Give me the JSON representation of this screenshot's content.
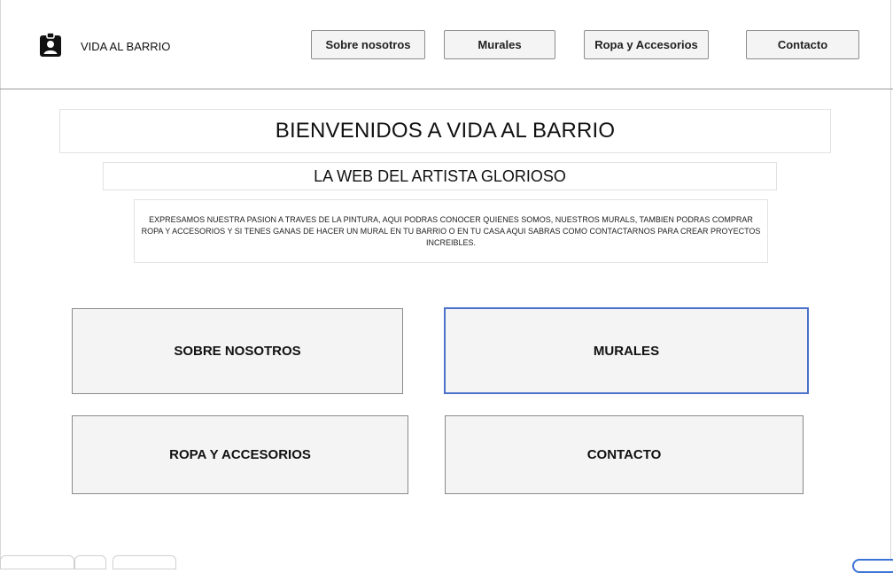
{
  "header": {
    "brand": "VIDA AL BARRIO",
    "logo_icon": "id-badge-icon",
    "nav": {
      "sobre": "Sobre nosotros",
      "murales": "Murales",
      "ropa": "Ropa y Accesorios",
      "contacto": "Contacto"
    }
  },
  "hero": {
    "title": "BIENVENIDOS A VIDA AL BARRIO",
    "subtitle": "LA WEB DEL ARTISTA GLORIOSO",
    "description": "EXPRESAMOS NUESTRA PASION A TRAVES DE LA PINTURA, AQUI PODRAS CONOCER QUIENES SOMOS, NUESTROS MURALS, TAMBIEN PODRAS COMPRAR ROPA Y ACCESORIOS Y SI TENES GANAS DE HACER UN MURAL EN TU BARRIO O EN TU CASA AQUI SABRAS COMO CONTACTARNOS PARA CREAR PROYECTOS INCREIBLES."
  },
  "tiles": {
    "sobre": "SOBRE NOSOTROS",
    "murales": "MURALES",
    "ropa": "ROPA Y ACCESORIOS",
    "contacto": "CONTACTO"
  },
  "colors": {
    "selected_border": "#4a72c9",
    "tile_bg": "#f4f4f4"
  }
}
